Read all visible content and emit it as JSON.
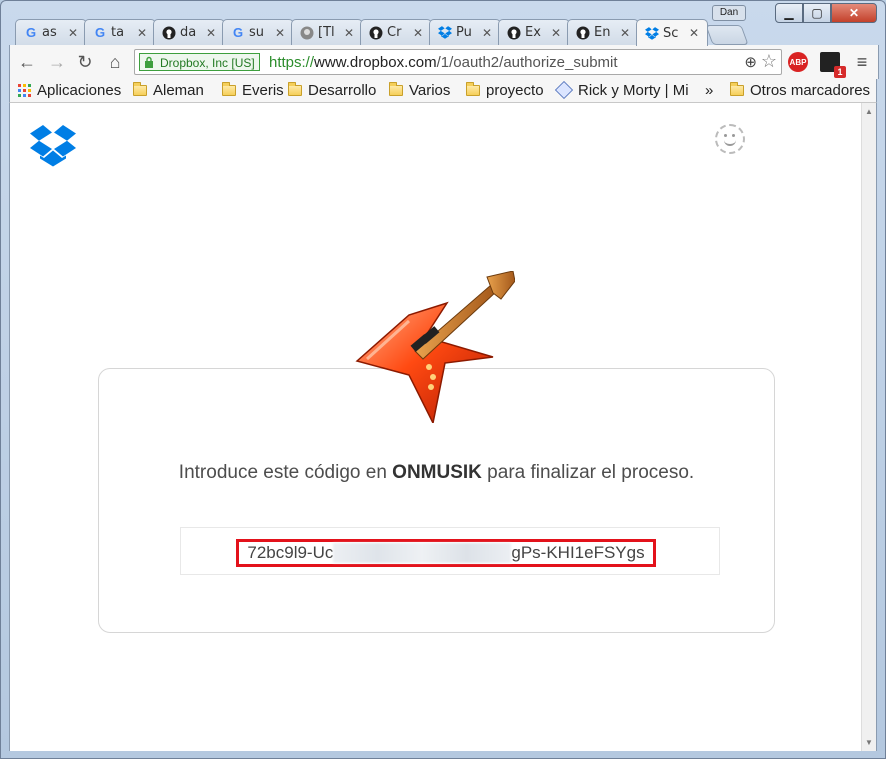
{
  "window": {
    "user_badge": "Dan"
  },
  "tabs": [
    {
      "label": "as",
      "favicon": "google",
      "active": false
    },
    {
      "label": "ta",
      "favicon": "google",
      "active": false
    },
    {
      "label": "da",
      "favicon": "github",
      "active": false
    },
    {
      "label": "su",
      "favicon": "google",
      "active": false
    },
    {
      "label": "[Tl",
      "favicon": "generic",
      "active": false
    },
    {
      "label": "Cr",
      "favicon": "github",
      "active": false
    },
    {
      "label": "Pu",
      "favicon": "dropbox",
      "active": false
    },
    {
      "label": "Ex",
      "favicon": "github",
      "active": false
    },
    {
      "label": "En",
      "favicon": "github",
      "active": false
    },
    {
      "label": "Sc",
      "favicon": "dropbox",
      "active": true
    }
  ],
  "omnibox": {
    "ev_label": "Dropbox, Inc [US]",
    "protocol": "https://",
    "host": "www.dropbox.com",
    "path": "/1/oauth2/authorize_submit"
  },
  "extensions": {
    "abp_label": "ABP",
    "badge_count": "1"
  },
  "bookmarks": [
    {
      "label": "Aplicaciones",
      "icon": "apps-icon"
    },
    {
      "label": "Aleman",
      "icon": "folder-icon"
    },
    {
      "label": "Everis",
      "icon": "folder-icon"
    },
    {
      "label": "Desarrollo",
      "icon": "folder-icon"
    },
    {
      "label": "Varios",
      "icon": "folder-icon"
    },
    {
      "label": "proyecto",
      "icon": "folder-icon"
    },
    {
      "label": "Rick y Morty | Mi",
      "icon": "cube-icon"
    },
    {
      "label": "»",
      "icon": ""
    },
    {
      "label": "Otros marcadores",
      "icon": "folder-icon"
    }
  ],
  "page": {
    "message_before": "Introduce este código en ",
    "app_name": "ONMUSIK",
    "message_after": " para finalizar el proceso.",
    "code_prefix": "72bc9l9-Uc",
    "code_suffix": "gPs-KHI1eFSYgs"
  },
  "colors": {
    "dropbox_blue": "#007ee5",
    "highlight_red": "#e3121b"
  }
}
